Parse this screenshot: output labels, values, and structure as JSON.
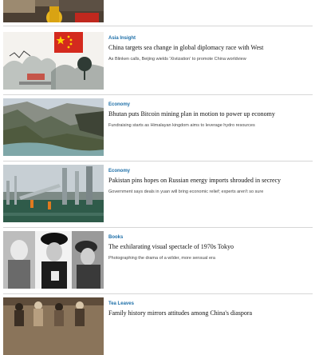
{
  "articles": [
    {
      "category": "",
      "headline": "",
      "summary": "",
      "image": "person-in-yellow-photo"
    },
    {
      "category": "Asia Insight",
      "headline": "China targets sea change in global diplomacy race with West",
      "summary": "As Blinken calls, Beijing wields 'Xiviization' to promote China worldview",
      "image": "chinese-flag-ink-landscape-illustration"
    },
    {
      "category": "Economy",
      "headline": "Bhutan puts Bitcoin mining plan in motion to power up economy",
      "summary": "Fundraising starts as Himalayan kingdom aims to leverage hydro resources",
      "image": "himalayan-river-valley-photo"
    },
    {
      "category": "Economy",
      "headline": "Pakistan pins hopes on Russian energy imports shrouded in secrecy",
      "summary": "Government says deals in yuan will bring economic relief; experts aren't so sure",
      "image": "oil-pipeline-jetty-workers-photo"
    },
    {
      "category": "Books",
      "headline": "The exhilarating visual spectacle of 1970s Tokyo",
      "summary": "Photographing the drama of a wilder, more sensual era",
      "image": "black-and-white-tokyo-portraits-photo"
    },
    {
      "category": "Tea Leaves",
      "headline": "Family history mirrors attitudes among China's diaspora",
      "summary": "",
      "image": "family-group-sepia-photo"
    }
  ]
}
